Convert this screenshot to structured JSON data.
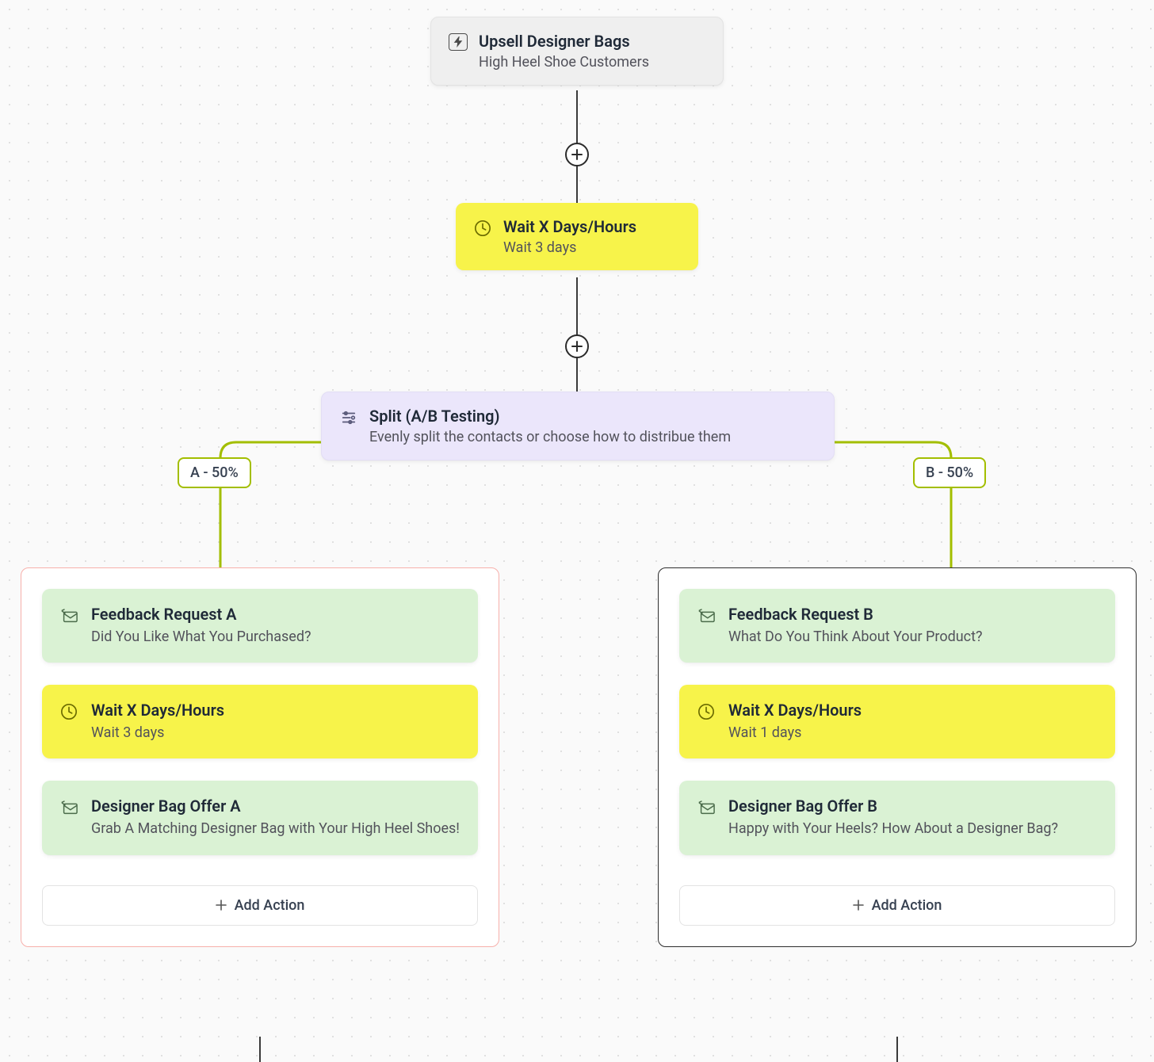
{
  "trigger": {
    "title": "Upsell Designer Bags",
    "subtitle": "High Heel Shoe Customers"
  },
  "wait_top": {
    "title": "Wait X Days/Hours",
    "subtitle": "Wait 3 days"
  },
  "split": {
    "title": "Split (A/B Testing)",
    "subtitle": "Evenly split the contacts or choose how to distribue them"
  },
  "labels": {
    "a": "A - 50%",
    "b": "B - 50%"
  },
  "branch_a": {
    "feedback": {
      "title": "Feedback Request A",
      "subtitle": "Did You Like What You Purchased?"
    },
    "wait": {
      "title": "Wait X Days/Hours",
      "subtitle": "Wait 3 days"
    },
    "offer": {
      "title": "Designer Bag Offer A",
      "subtitle": "Grab A Matching Designer Bag with Your High Heel Shoes!"
    },
    "add_action": "Add Action"
  },
  "branch_b": {
    "feedback": {
      "title": "Feedback Request B",
      "subtitle": "What Do You Think About Your Product?"
    },
    "wait": {
      "title": "Wait X Days/Hours",
      "subtitle": "Wait 1 days"
    },
    "offer": {
      "title": "Designer Bag Offer B",
      "subtitle": "Happy with Your Heels? How About a Designer Bag?"
    },
    "add_action": "Add Action"
  }
}
